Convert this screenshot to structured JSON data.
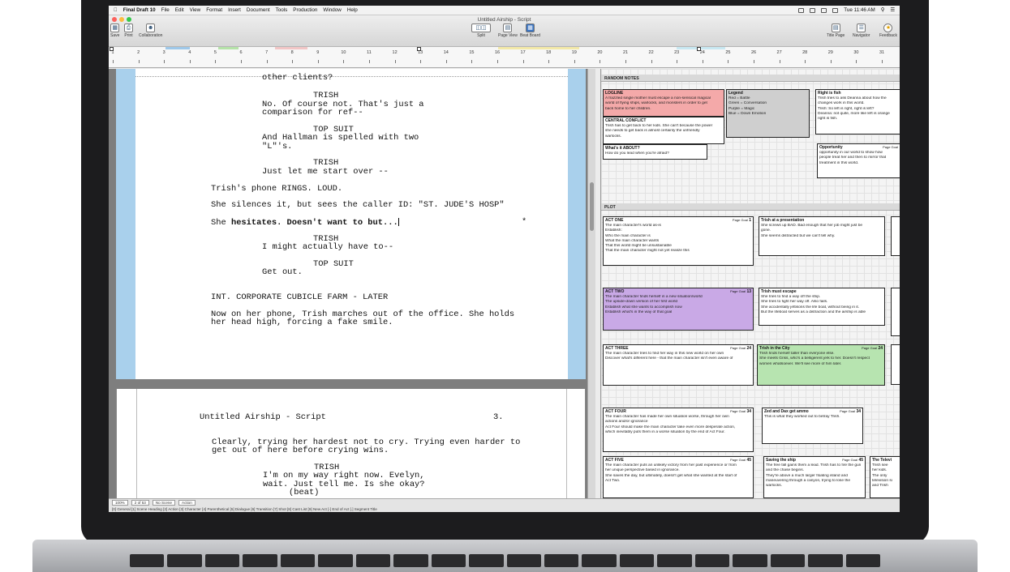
{
  "menubar": {
    "app_name": "Final Draft 10",
    "items": [
      "File",
      "Edit",
      "View",
      "Format",
      "Insert",
      "Document",
      "Tools",
      "Production",
      "Window",
      "Help"
    ],
    "clock": "Tue 11:46 AM"
  },
  "window": {
    "title": "Untitled Airship - Script"
  },
  "toolbar": {
    "save": "Save",
    "print": "Print",
    "collaboration": "Collaboration",
    "split": "Split",
    "page_view": "Page View",
    "beat_board": "Beat Board",
    "title_page": "Title Page",
    "navigator": "Navigator",
    "feedback": "Feedback"
  },
  "ruler": {
    "numbers": [
      "1",
      "2",
      "3",
      "4",
      "5",
      "6",
      "7",
      "8",
      "9",
      "10",
      "11",
      "12",
      "13",
      "14",
      "15",
      "16",
      "17",
      "18",
      "19",
      "20",
      "21",
      "22",
      "23",
      "24",
      "25",
      "26",
      "27",
      "28",
      "29",
      "30",
      "31"
    ]
  },
  "script_page1": {
    "lines": [
      "other clients?",
      "TRISH",
      "No. Of course not. That's just a",
      "comparison for ref--",
      "TOP SUIT",
      "And Hallman is spelled with two",
      "\"L\"'s.",
      "TRISH",
      "Just let me start over --",
      "Trish's phone RINGS. LOUD.",
      "She silences it, but sees the caller ID: \"ST. JUDE'S HOSP\"",
      "She ",
      "hesitates. Doesn't want to but...",
      "*",
      "TRISH",
      "I might actually have to--",
      "TOP SUIT",
      "Get out.",
      "INT. CORPORATE CUBICLE FARM - LATER",
      "Now on her phone, Trish marches out of the office. She holds",
      "her head high, forcing a fake smile."
    ]
  },
  "script_page2": {
    "header": "Untitled Airship - Script",
    "page_number": "3.",
    "lines": [
      "Clearly, trying her hardest not to cry. Trying even harder to",
      "get out of here before crying wins.",
      "TRISH",
      "I'm on my way right now. Evelyn,",
      "wait. Just tell me. Is she okay?",
      "(beat)"
    ]
  },
  "statusbar": {
    "zoom": "100%",
    "page": "2 of 53",
    "scene": "No Scene",
    "element": "Action",
    "shortcuts": "[0] General  [1] Scene Heading  [2] Action  [3] Character  [4] Parenthetical  [5] Dialogue  [6] Transition  [7] Shot  [8] Cast List  [9] New Act  [-] End of Act  [.] Segment Title"
  },
  "beat_board": {
    "random_notes_title": "RANDOM NOTES",
    "plot_title": "PLOT",
    "cards": {
      "logline": {
        "title": "LOGLINE",
        "lines": [
          "A frazzled single mother must escape a non-sensical magical",
          "world of flying ships, warlocks, and monsters in order to get",
          "back home to her children."
        ]
      },
      "legend": {
        "title": "Legend",
        "lines": [
          "Red = Battle",
          "Green = Conversation",
          "Purple = Magic",
          "Blue = Down Emotion"
        ]
      },
      "right_is_fish": {
        "title": "Right is fish",
        "lines": [
          "Trish tries to ask Deanna about how the",
          "changes work in this world.",
          "",
          "Trish: So left is right, right is left?",
          "",
          "Deanna: not quite, more like left is orange",
          "right is fish."
        ]
      },
      "central_conflict": {
        "title": "CENTRAL CONFLICT",
        "lines": [
          "Trish has to get back to her kids. She can't because the power",
          "she needs to get back is almost certainly the unfriendly",
          "warlocks."
        ]
      },
      "whats_it_about": {
        "title": "What's it ABOUT?",
        "lines": [
          "How do you lead when you're afraid?"
        ]
      },
      "opportunity": {
        "title": "Opportunity",
        "page_goal": "Page Goal",
        "lines": [
          "opportunity in our world to show how",
          "people treat her and then to mirror that",
          "treatment in this world."
        ]
      },
      "act_one": {
        "title": "ACT ONE",
        "page_goal": "Page Goal",
        "num": "1",
        "lines": [
          "The main character's world as-is",
          "Establish:",
          "Who the main character is",
          "What the main character wants",
          "That this world might be unsustainable",
          "That the main character might not yet realize this"
        ]
      },
      "presentation": {
        "title": "Trish at a presentation",
        "lines": [
          "She screws up BAD. Bad enough that her job might just be",
          "gone.",
          "She seems distracted but we can't tell why."
        ]
      },
      "act_two": {
        "title": "ACT TWO",
        "page_goal": "Page Goal",
        "num": "13",
        "lines": [
          "The main character finds herself in a new situation/world",
          "The upside-down version of her first world",
          "Establish what she wants to accomplish now",
          "Establish what's in the way of that goal"
        ]
      },
      "must_escape": {
        "title": "Trish must escape",
        "lines": [
          "She tries to find a way off the ship.",
          "She tries to fight her way off. Also fails.",
          "She accidentally jettisons the life boat, without being in it.",
          "But the lifeboat serves as a distraction and the airship is able"
        ]
      },
      "act_three": {
        "title": "ACT THREE",
        "page_goal": "Page Goal",
        "num": "24",
        "lines": [
          "The main character tries to find her way in this new world on her own",
          "Discover what's different here - that the main character isn't even aware of"
        ]
      },
      "in_the_city": {
        "title": "Trish in the City",
        "page_goal": "Page Goal",
        "num": "24",
        "lines": [
          "Trish finds herself taller than everyone else.",
          "",
          "She meets Griss, who's a belligerent jerk to her. Doesn't respect",
          "women whatsoever. We'll see more of him later."
        ]
      },
      "act_four": {
        "title": "ACT FOUR",
        "page_goal": "Page Goal",
        "num": "34",
        "lines": [
          "The main character has made her own situation worse, through her own",
          "actions and/or ignorance",
          "Act Four should make the main character take even more desperate action,",
          "which inevitably puts them in a worse situation by the end of Act Four."
        ]
      },
      "zed_dax": {
        "title": "Zed and Dax get ammo",
        "page_goal": "Page Goal",
        "num": "34",
        "lines": [
          "This is what they worked out to betray Trish."
        ]
      },
      "act_five": {
        "title": "ACT FIVE",
        "page_goal": "Page Goal",
        "num": "45",
        "lines": [
          "The main character puts an unlikely victory from her past experience or from",
          "her unique perspective based in ignorance.",
          "She saves the day, but ultimately, doesn't get what she wanted at the start of",
          "Act Two."
        ]
      },
      "saving_ship": {
        "title": "Saving the ship",
        "page_goal": "Page Goal",
        "num": "45",
        "lines": [
          "The free fall gains them a lead. Trish has to fire the gun",
          "and the chase begins.",
          "",
          "They're above a much larger floating island and",
          "maneuvering through a canyon, trying to lose the",
          "warlocks."
        ]
      },
      "edge_right_1": {
        "title": "The Televi",
        "lines": [
          "Trish see",
          "her kids.",
          "",
          "The only",
          "television si",
          "and Trish",
          "",
          "No one el",
          "as it pas",
          "of the tele"
        ]
      }
    }
  },
  "colors": {
    "logline_bg": "#f4a9a9",
    "legend_bg": "#cfcfcf",
    "act_two_bg": "#c9a9e6",
    "in_city_bg": "#b7e4b0",
    "script_page_bg": "#a9d0ec"
  }
}
